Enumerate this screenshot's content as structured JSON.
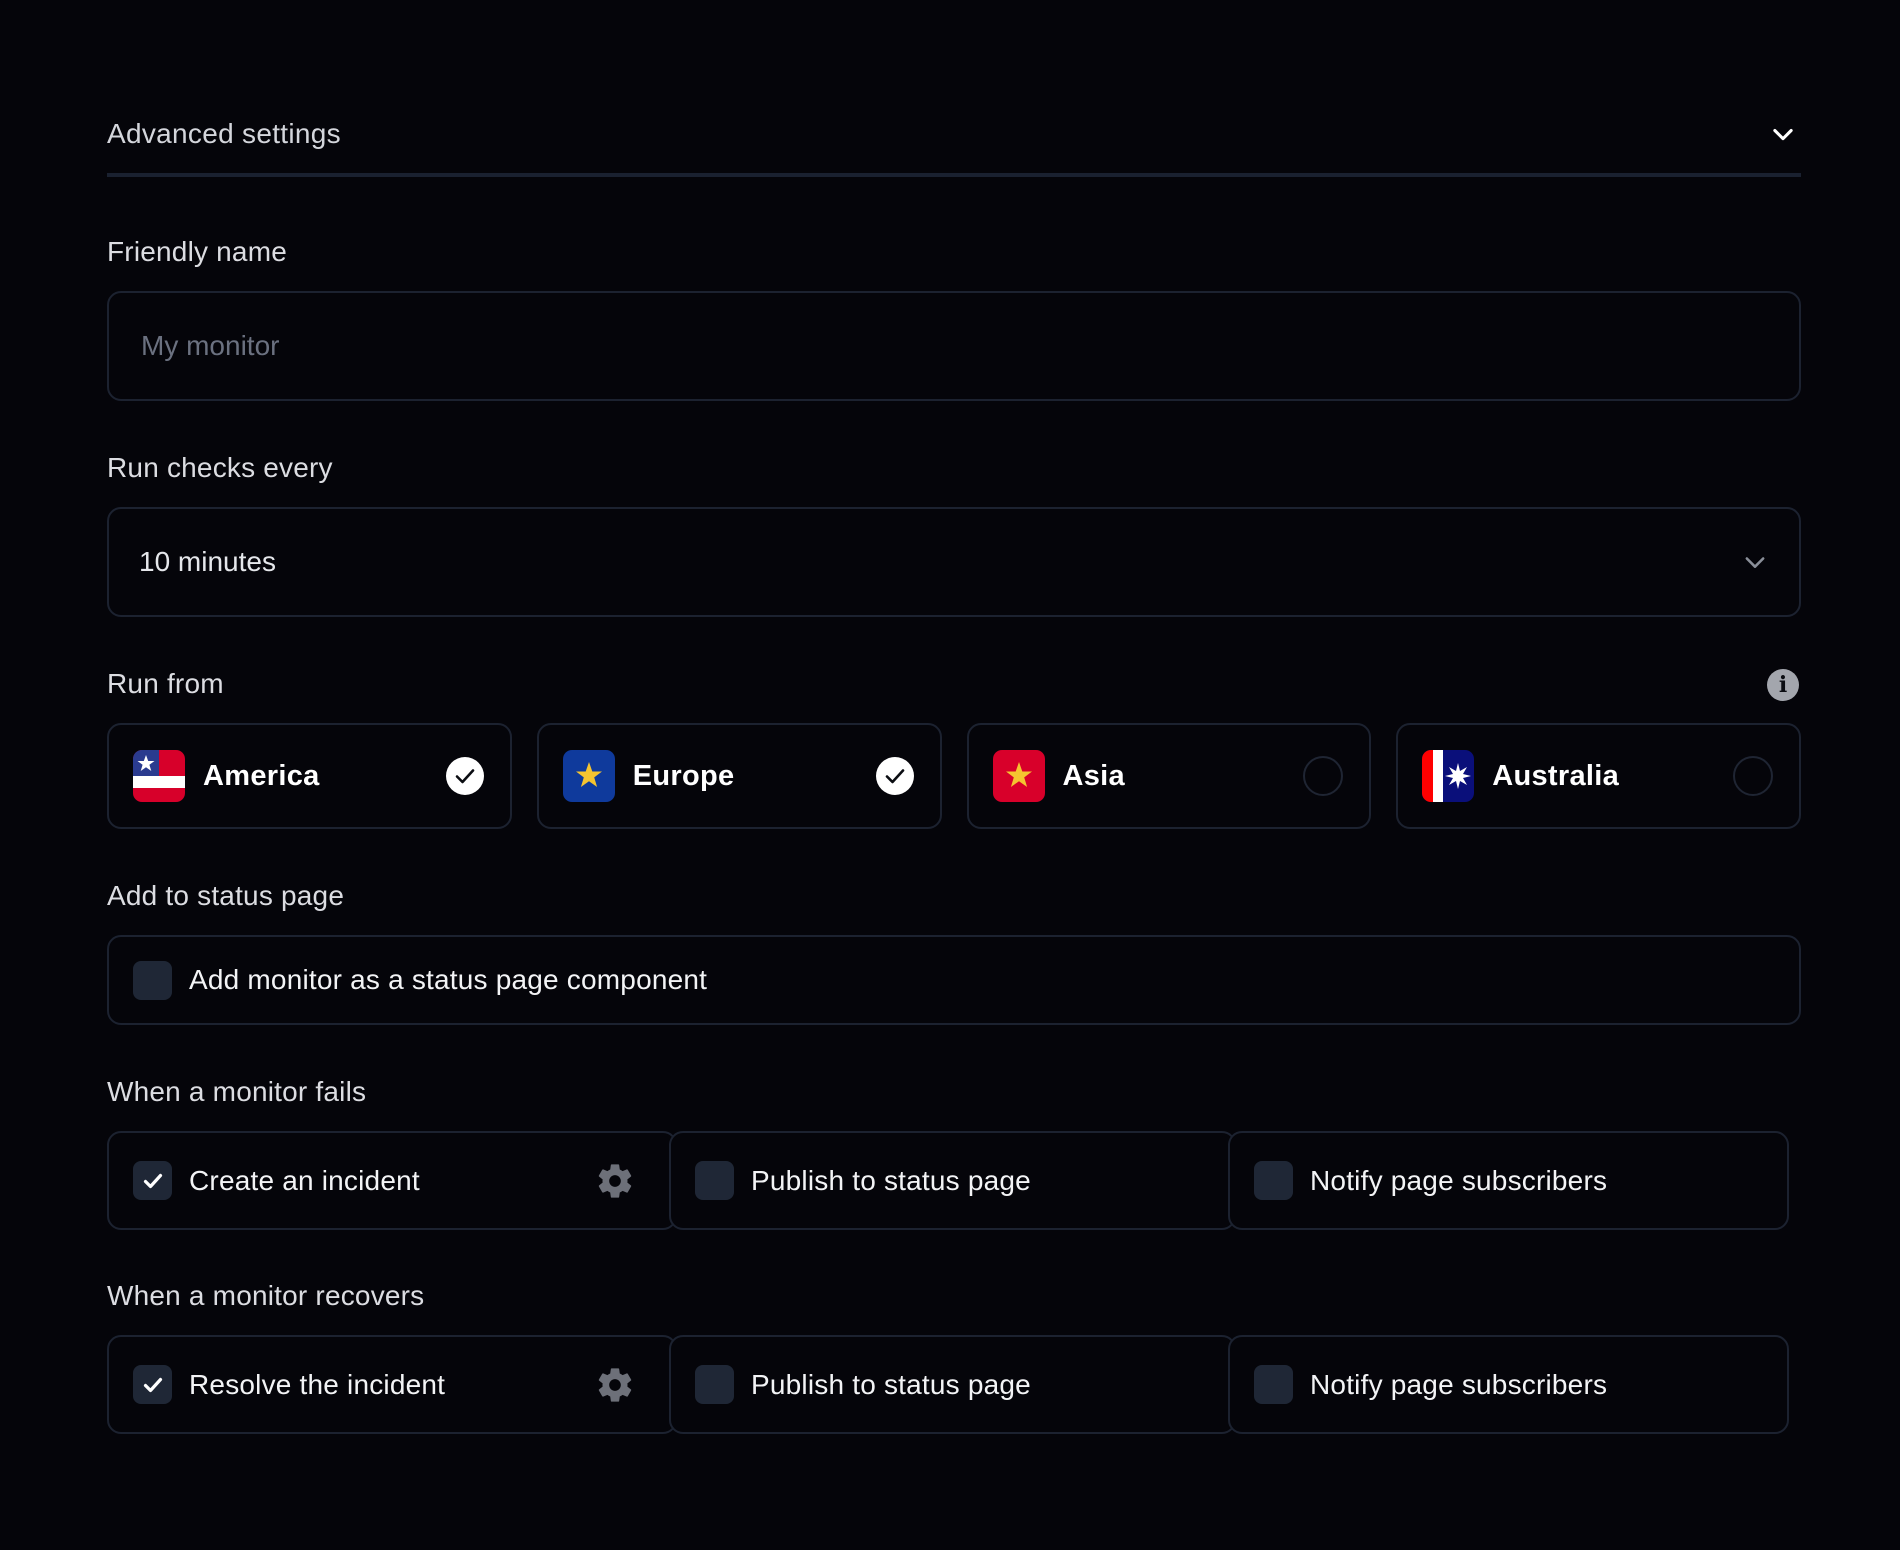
{
  "header": {
    "title": "Advanced settings",
    "expanded": true,
    "icon": "chevron-down-icon"
  },
  "friendly_name": {
    "label": "Friendly name",
    "value": "",
    "placeholder": "My monitor"
  },
  "run_checks": {
    "label": "Run checks every",
    "selected": "10 minutes",
    "icon": "chevron-down-icon"
  },
  "run_from": {
    "label": "Run from",
    "info_icon": "info-icon",
    "regions": [
      {
        "name": "America",
        "flag": "america-flag-icon",
        "selected": true
      },
      {
        "name": "Europe",
        "flag": "europe-flag-icon",
        "selected": true
      },
      {
        "name": "Asia",
        "flag": "asia-flag-icon",
        "selected": false
      },
      {
        "name": "Australia",
        "flag": "australia-flag-icon",
        "selected": false
      }
    ]
  },
  "status_page": {
    "label": "Add to status page",
    "option": "Add monitor as a status page component",
    "checked": false
  },
  "on_fail": {
    "label": "When a monitor fails",
    "options": [
      {
        "label": "Create an incident",
        "checked": true,
        "has_settings": true
      },
      {
        "label": "Publish to status page",
        "checked": false,
        "has_settings": false
      },
      {
        "label": "Notify page subscribers",
        "checked": false,
        "has_settings": false
      }
    ]
  },
  "on_recover": {
    "label": "When a monitor recovers",
    "options": [
      {
        "label": "Resolve the incident",
        "checked": true,
        "has_settings": true
      },
      {
        "label": "Publish to status page",
        "checked": false,
        "has_settings": false
      },
      {
        "label": "Notify page subscribers",
        "checked": false,
        "has_settings": false
      }
    ]
  },
  "colors": {
    "background": "#05050a",
    "border": "#1c2230",
    "checkbox": "#1f2736",
    "text": "#e5e7eb",
    "muted": "#6b7180"
  }
}
